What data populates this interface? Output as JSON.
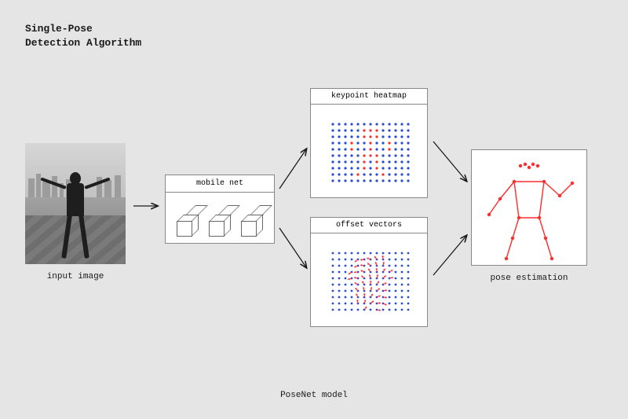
{
  "title_line1": "Single-Pose",
  "title_line2": "Detection Algorithm",
  "stages": {
    "input": {
      "label": "input image"
    },
    "mobilenet": {
      "header": "mobile net"
    },
    "heatmap": {
      "header": "keypoint heatmap"
    },
    "offsets": {
      "header": "offset vectors"
    },
    "pose": {
      "label": "pose estimation"
    }
  },
  "caption": "PoseNet model",
  "colors": {
    "accent": "#ff2c2c",
    "dot": "#2b4bd8"
  },
  "chart_data": {
    "type": "diagram",
    "flow": [
      "input image",
      "mobile net",
      [
        "keypoint heatmap",
        "offset vectors"
      ],
      "pose estimation"
    ],
    "heatmap": {
      "grid": [
        13,
        10
      ],
      "active_cells": [
        [
          5,
          1
        ],
        [
          6,
          1
        ],
        [
          7,
          1
        ],
        [
          5,
          2
        ],
        [
          6,
          2
        ],
        [
          7,
          2
        ],
        [
          3,
          3
        ],
        [
          6,
          3
        ],
        [
          9,
          3
        ],
        [
          3,
          4
        ],
        [
          6,
          4
        ],
        [
          9,
          4
        ],
        [
          5,
          5
        ],
        [
          6,
          5
        ],
        [
          7,
          5
        ],
        [
          5,
          6
        ],
        [
          7,
          6
        ],
        [
          5,
          7
        ],
        [
          7,
          7
        ],
        [
          4,
          8
        ],
        [
          8,
          8
        ]
      ]
    },
    "offset_vectors": {
      "grid": [
        13,
        10
      ],
      "vectors_region": "center human silhouette, arrows pointing toward keypoints"
    },
    "pose_keypoints": [
      "nose",
      "leftEye",
      "rightEye",
      "leftEar",
      "rightEar",
      "leftShoulder",
      "rightShoulder",
      "leftElbow",
      "rightElbow",
      "leftWrist",
      "rightWrist",
      "leftHip",
      "rightHip",
      "leftKnee",
      "rightKnee",
      "leftAnkle",
      "rightAnkle"
    ]
  }
}
